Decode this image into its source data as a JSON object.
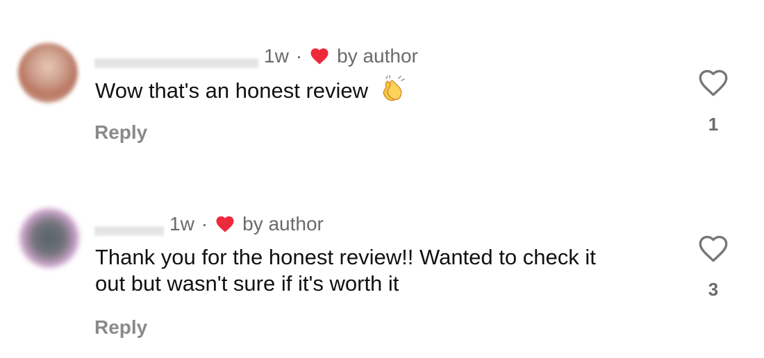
{
  "comments": [
    {
      "timestamp": "1w",
      "separator": "·",
      "liked_by": "by author",
      "text": "Wow that's an honest review",
      "emoji": "clapping-hands",
      "reply_label": "Reply",
      "like_count": "1"
    },
    {
      "timestamp": "1w",
      "separator": "·",
      "liked_by": "by author",
      "text": "Thank you for the honest review!! Wanted to check it out but wasn't sure if it's worth it",
      "reply_label": "Reply",
      "like_count": "3"
    }
  ],
  "colors": {
    "author_heart": "#ed2a3c",
    "meta_text": "#6a6a6a",
    "reply_text": "#8a8a8a",
    "body_text": "#111111"
  },
  "icons": {
    "author_like": "heart-icon",
    "like_button": "heart-outline-icon"
  }
}
